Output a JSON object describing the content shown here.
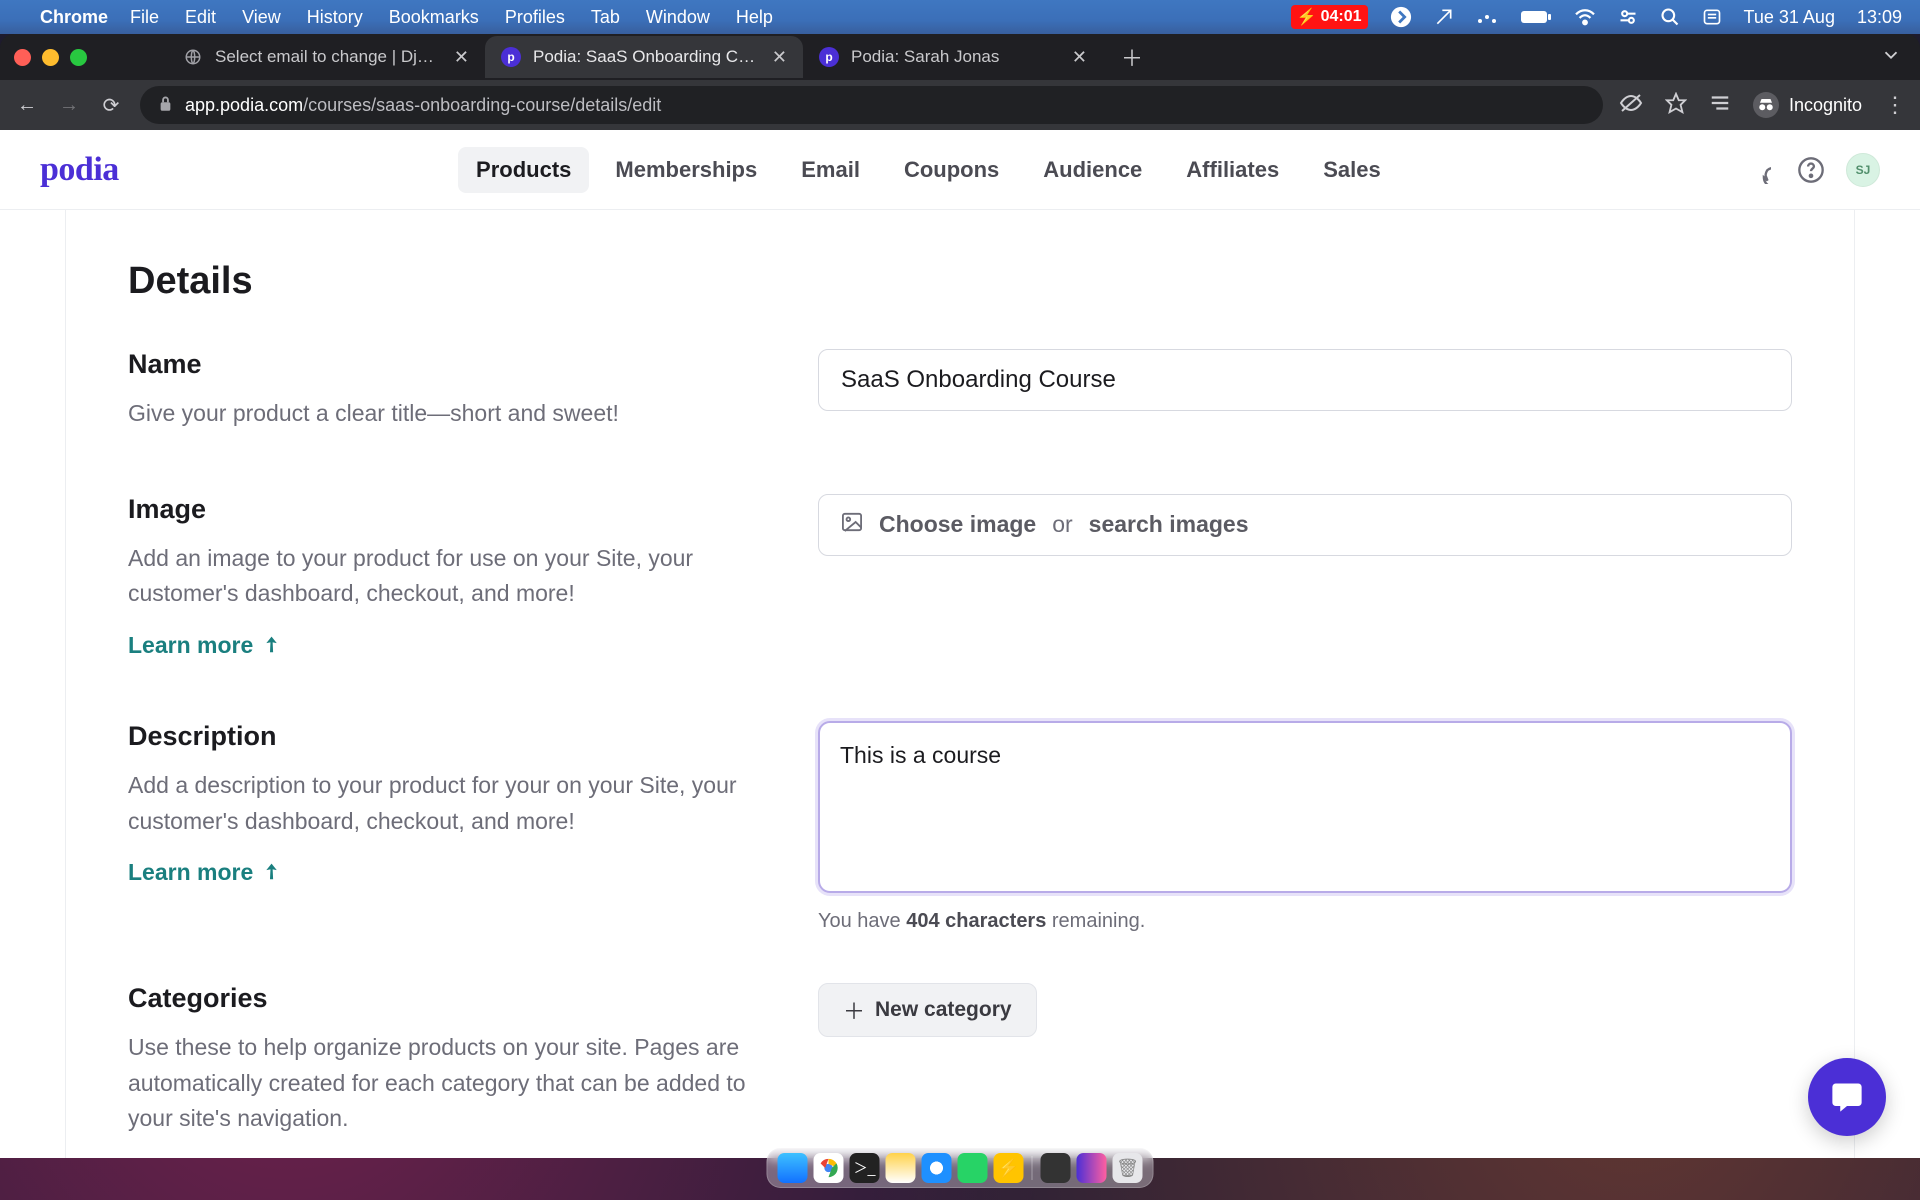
{
  "menubar": {
    "app": "Chrome",
    "items": [
      "File",
      "Edit",
      "View",
      "History",
      "Bookmarks",
      "Profiles",
      "Tab",
      "Window",
      "Help"
    ],
    "battery_time": "04:01",
    "date": "Tue 31 Aug",
    "time": "13:09"
  },
  "tabs": {
    "t0": "Select email to change | Django",
    "t1": "Podia: SaaS Onboarding Course",
    "t2": "Podia: Sarah Jonas"
  },
  "url": {
    "host": "app.podia.com",
    "path": "/courses/saas-onboarding-course/details/edit"
  },
  "incognito_label": "Incognito",
  "podia_nav": {
    "products": "Products",
    "memberships": "Memberships",
    "email": "Email",
    "coupons": "Coupons",
    "audience": "Audience",
    "affiliates": "Affiliates",
    "sales": "Sales"
  },
  "avatar_initials": "SJ",
  "page": {
    "title": "Details",
    "name": {
      "label": "Name",
      "desc": "Give your product a clear title—short and sweet!",
      "value": "SaaS Onboarding Course"
    },
    "image": {
      "label": "Image",
      "desc": "Add an image to your product for use on your Site, your customer's dashboard, checkout, and more!",
      "learn_more": "Learn more",
      "picker_choose": "Choose image",
      "picker_or": "or",
      "picker_search": "search images"
    },
    "description": {
      "label": "Description",
      "desc": "Add a description to your product for your on your Site, your customer's dashboard, checkout, and more!",
      "learn_more": "Learn more",
      "value": "This is a course",
      "count_pre": "You have ",
      "count_bold": "404 characters",
      "count_post": " remaining."
    },
    "categories": {
      "label": "Categories",
      "desc": "Use these to help organize products on your site. Pages are automatically created for each category that can be added to your site's navigation.",
      "button": "New category"
    }
  }
}
